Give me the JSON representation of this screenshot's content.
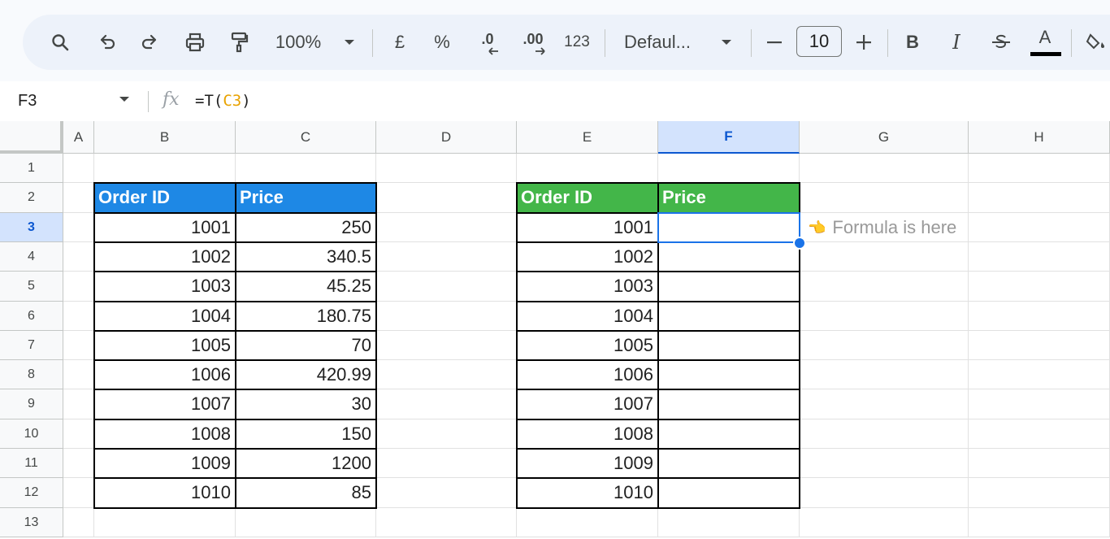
{
  "toolbar": {
    "zoom": "100%",
    "currency": "£",
    "percent": "%",
    "dec_decrease": ".0",
    "dec_increase": ".00",
    "number_format": "123",
    "font": "Defaul...",
    "font_size": "10",
    "bold": "B",
    "italic": "I",
    "text_color_label": "A"
  },
  "formula_bar": {
    "cell_ref": "F3",
    "fx": "fx",
    "formula_prefix": "=T(",
    "formula_ref": "C3",
    "formula_suffix": ")"
  },
  "columns": [
    "A",
    "B",
    "C",
    "D",
    "E",
    "F",
    "G",
    "H"
  ],
  "selected_column": "F",
  "rows": [
    "1",
    "2",
    "3",
    "4",
    "5",
    "6",
    "7",
    "8",
    "9",
    "10",
    "11",
    "12",
    "13"
  ],
  "selected_row": "3",
  "table_left": {
    "headers": [
      "Order ID",
      "Price"
    ],
    "header_color": "#1e88e5",
    "rows": [
      [
        "1001",
        "250"
      ],
      [
        "1002",
        "340.5"
      ],
      [
        "1003",
        "45.25"
      ],
      [
        "1004",
        "180.75"
      ],
      [
        "1005",
        "70"
      ],
      [
        "1006",
        "420.99"
      ],
      [
        "1007",
        "30"
      ],
      [
        "1008",
        "150"
      ],
      [
        "1009",
        "1200"
      ],
      [
        "1010",
        "85"
      ]
    ]
  },
  "table_right": {
    "headers": [
      "Order ID",
      "Price"
    ],
    "header_color": "#43b649",
    "order_ids": [
      "1001",
      "1002",
      "1003",
      "1004",
      "1005",
      "1006",
      "1007",
      "1008",
      "1009",
      "1010"
    ]
  },
  "note": {
    "hand_icon": "👈",
    "text": "Formula is here"
  }
}
